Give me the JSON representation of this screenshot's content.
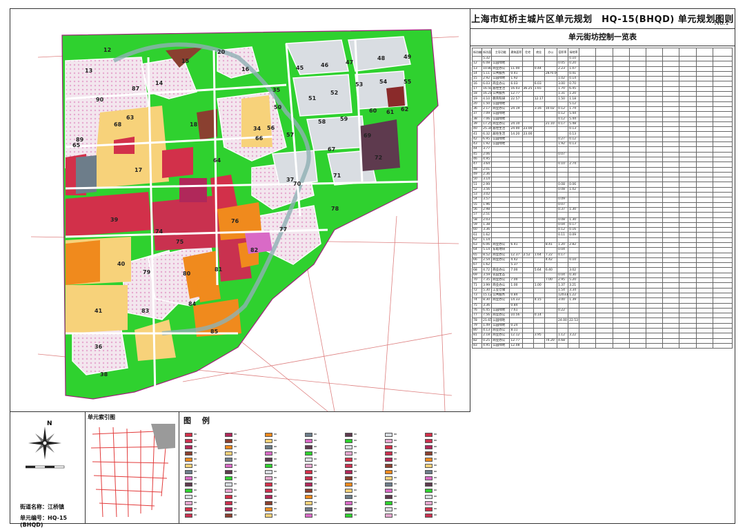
{
  "title": "上海市虹桥主城片区单元规划　HQ-15(BHQD) 单元规划图则",
  "sheet_no": "No.1",
  "table_title": "单元街坊控制一览表",
  "info": {
    "street": "街道名称：江桥镇",
    "unit_no": "单元编号：HQ-15 (BHQD)"
  },
  "compass_label": "N",
  "index_map_title": "单元索引图",
  "legend_title": "图 例",
  "plot_numbers": [
    "12",
    "13",
    "14",
    "15",
    "16",
    "17",
    "18",
    "20",
    "34",
    "35",
    "36",
    "37",
    "38",
    "39",
    "40",
    "41",
    "45",
    "46",
    "47",
    "48",
    "49",
    "50",
    "51",
    "52",
    "53",
    "54",
    "55",
    "56",
    "57",
    "58",
    "59",
    "60",
    "61",
    "62",
    "63",
    "64",
    "65",
    "66",
    "67",
    "68",
    "69",
    "70",
    "71",
    "72",
    "74",
    "75",
    "76",
    "77",
    "78",
    "79",
    "80",
    "81",
    "82",
    "83",
    "84",
    "85",
    "87",
    "89",
    "90"
  ],
  "table_rows": [
    [
      "",
      "5.32",
      "",
      "",
      "",
      "",
      "",
      "",
      "0.10"
    ],
    [
      "12",
      "6.08",
      "公园绿地",
      "",
      "",
      "",
      "",
      "0.05",
      "0.20"
    ],
    [
      "13",
      "10.80",
      "商业办公",
      "11.00",
      "",
      "0.44",
      "",
      "2.23",
      "1.07"
    ],
    [
      "14",
      "5.11",
      "公共服务",
      "0.41",
      "",
      "",
      "2870.00",
      "",
      "0.41"
    ],
    [
      "15",
      "2.92",
      "公园绿地",
      "1.92",
      "",
      "",
      "",
      "1.02",
      "0.14"
    ],
    [
      "16",
      "6.03",
      "商业办公",
      "6.03",
      "",
      "6.03",
      "",
      "3.00",
      "0.70"
    ],
    [
      "17",
      "16.50",
      "居住生活",
      "16.03",
      "36.25",
      "1.65",
      "",
      "1.70",
      "6.45"
    ],
    [
      "18",
      "16.21",
      "公共服务",
      "12.77",
      "",
      "",
      "",
      "1.31",
      "1.20"
    ],
    [
      "19",
      "4.10",
      "教育科研",
      "22.57",
      "",
      "12.17",
      "",
      "1.50",
      "1.18"
    ],
    [
      "20",
      "1.50",
      "公园绿地",
      "",
      "",
      "",
      "",
      "",
      "5.12"
    ],
    [
      "36",
      "2.17",
      "商业办公",
      "24.19",
      "",
      "3.16",
      "10.02",
      "0.12",
      "1.74"
    ],
    [
      "37",
      "7.09",
      "公园绿地",
      "",
      "",
      "",
      "",
      "0.12",
      "5.44"
    ],
    [
      "38",
      "7.06",
      "公园绿地",
      "",
      "",
      "",
      "",
      "0.12",
      "5.44"
    ],
    [
      "39",
      "17.25",
      "商业办公",
      "24.10",
      "",
      "",
      "21.10",
      "0.17",
      "5.48"
    ],
    [
      "40",
      "25.34",
      "居住生活",
      "24.00",
      "23.00",
      "",
      "",
      "",
      "0.13"
    ],
    [
      "41",
      "6.32",
      "居住生活",
      "14.20",
      "23.00",
      "",
      "",
      "",
      "0.13"
    ],
    [
      "42",
      "6.95",
      "公园绿地",
      "",
      "",
      "",
      "",
      "0.27",
      "0.12"
    ],
    [
      "43",
      "1.92",
      "公园绿地",
      "",
      "",
      "",
      "",
      "1.92",
      "0.13"
    ],
    [
      "44",
      "3.77",
      "",
      "",
      "",
      "",
      "",
      "",
      ""
    ],
    [
      "45",
      "2.06",
      "",
      "",
      "",
      "",
      "",
      "0.07",
      ""
    ],
    [
      "46",
      "4.95",
      "",
      "",
      "",
      "",
      "",
      "",
      ""
    ],
    [
      "47",
      "3.64",
      "",
      "",
      "",
      "",
      "",
      "0.10",
      "2.74"
    ],
    [
      "48",
      "2.01",
      "",
      "",
      "",
      "",
      "",
      "",
      ""
    ],
    [
      "49",
      "2.36",
      "",
      "",
      "",
      "",
      "",
      "",
      ""
    ],
    [
      "50",
      "3.14",
      "",
      "",
      "",
      "",
      "",
      "",
      ""
    ],
    [
      "51",
      "2.99",
      "",
      "",
      "",
      "",
      "",
      "0.08",
      "0.06"
    ],
    [
      "52",
      "3.56",
      "",
      "",
      "",
      "",
      "",
      "0.08",
      "1.02"
    ],
    [
      "53",
      "3.02",
      "",
      "",
      "",
      "",
      "",
      "",
      ""
    ],
    [
      "54",
      "3.57",
      "",
      "",
      "",
      "",
      "",
      "0.09",
      ""
    ],
    [
      "55",
      "1.96",
      "",
      "",
      "",
      "",
      "",
      "0.07",
      ""
    ],
    [
      "56",
      "2.98",
      "",
      "",
      "",
      "",
      "",
      "0.37",
      "1.30"
    ],
    [
      "57",
      "2.51",
      "",
      "",
      "",
      "",
      "",
      "",
      ""
    ],
    [
      "58",
      "2.03",
      "",
      "",
      "",
      "",
      "",
      "0.08",
      "1.30"
    ],
    [
      "59",
      "1.38",
      "",
      "",
      "",
      "",
      "",
      "0.04",
      "0.17"
    ],
    [
      "60",
      "3.36",
      "",
      "",
      "",
      "",
      "",
      "0.12",
      "0.16"
    ],
    [
      "61",
      "1.62",
      "",
      "",
      "",
      "",
      "",
      "0.11",
      "0.09"
    ],
    [
      "62",
      "1.14",
      "",
      "",
      "",
      "",
      "",
      "",
      ""
    ],
    [
      "63",
      "6.06",
      "商业办公",
      "6.41",
      "",
      "",
      "8.41",
      "1.20",
      "2.82"
    ],
    [
      "64",
      "5.14",
      "东岐地块",
      "",
      "",
      "",
      "",
      "0.04",
      ""
    ],
    [
      "65",
      "8.52",
      "商业办公",
      "12.37",
      "2.52",
      "1.64",
      "7.22",
      "0.17",
      ""
    ],
    [
      "66",
      "2.54",
      "商业办公",
      "4.42",
      "",
      "",
      "4.42",
      "",
      "0.10"
    ],
    [
      "67",
      "1.62",
      "",
      "5.37",
      "",
      "",
      "",
      "",
      ""
    ],
    [
      "68",
      "4.72",
      "商业办公",
      "7.00",
      "",
      "5.64",
      "6.40",
      "",
      "3.02"
    ],
    [
      "69",
      "3.59",
      "农田生态",
      "",
      "",
      "",
      "",
      "0.04",
      "0.30"
    ],
    [
      "70",
      "7.35",
      "商业办公",
      "7.00",
      "",
      "",
      "7.00",
      "2.95",
      "5.20"
    ],
    [
      "71",
      "3.99",
      "商业办公",
      "1.00",
      "",
      "1.00",
      "",
      "1.37",
      "3.21"
    ],
    [
      "72",
      "5.30",
      "工业仓储",
      "",
      "",
      "",
      "",
      "1.54",
      "3.34"
    ],
    [
      "73",
      "15.12",
      "公共服务",
      "0.84",
      "",
      "",
      "",
      "12033.00",
      "1.22"
    ],
    [
      "74",
      "8.30",
      "商业办公",
      "14.33",
      "",
      "4.15",
      "",
      "3.00",
      "1.39"
    ],
    [
      "75",
      "3.36",
      "",
      "0.84",
      "",
      "",
      "",
      "",
      ""
    ],
    [
      "76",
      "6.45",
      "公园绿地",
      "7.61",
      "",
      "",
      "",
      "0.22",
      ""
    ],
    [
      "77",
      "7.56",
      "商业办公",
      "10.56",
      "",
      "0.14",
      "",
      "",
      ""
    ],
    [
      "78",
      "21.65",
      "公园绿地",
      "",
      "",
      "",
      "",
      "24.00",
      "22.53"
    ],
    [
      "79",
      "1.49",
      "公园绿地",
      "0.24",
      "",
      "",
      "",
      "",
      ""
    ],
    [
      "80",
      "4.13",
      "商业办公",
      "8.11",
      "",
      "",
      "",
      "",
      ""
    ],
    [
      "81",
      "2.18",
      "商业办公",
      "12.12",
      "",
      "3.95",
      "",
      "1.12",
      "3.22"
    ],
    [
      "82",
      "0.25",
      "商业办公",
      "12.77",
      "",
      "",
      "74.20",
      "4.68",
      ""
    ],
    [
      "83",
      "4.95",
      "公园绿地",
      "12.08",
      "",
      "",
      "",
      "",
      ""
    ]
  ],
  "table_headers": [
    "街坊编号",
    "街坊面积(公顷)",
    "主导功能",
    "建筑面积",
    "住宅",
    "商业",
    "办公",
    "容积率",
    "绿地率"
  ]
}
